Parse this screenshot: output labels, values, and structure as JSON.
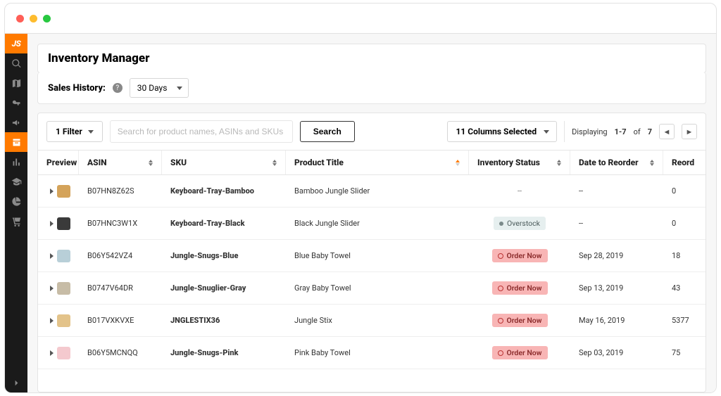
{
  "app": {
    "logo_text": "JS"
  },
  "sidebar": {
    "items": [
      {
        "name": "search"
      },
      {
        "name": "map"
      },
      {
        "name": "key"
      },
      {
        "name": "megaphone"
      },
      {
        "name": "inventory",
        "active": true
      },
      {
        "name": "bars"
      },
      {
        "name": "graduation"
      },
      {
        "name": "chart"
      },
      {
        "name": "cart"
      }
    ]
  },
  "page": {
    "title": "Inventory Manager",
    "history_label": "Sales History:",
    "history_value": "30 Days"
  },
  "toolbar": {
    "filter_label": "1 Filter",
    "search_placeholder": "Search for product names, ASINs and SKUs",
    "search_button": "Search",
    "columns_label": "11 Columns Selected",
    "displaying_label": "Displaying",
    "range": "1-7",
    "of": "of",
    "total": "7"
  },
  "columns": {
    "preview": "Preview",
    "asin": "ASIN",
    "sku": "SKU",
    "title": "Product Title",
    "status": "Inventory Status",
    "date": "Date to Reorder",
    "reorder": "Reord"
  },
  "status_labels": {
    "overstock": "Overstock",
    "order_now": "Order Now"
  },
  "rows": [
    {
      "asin": "B07HN8Z62S",
      "sku": "Keyboard-Tray-Bamboo",
      "title": "Bamboo Jungle Slider",
      "status": "dash",
      "date": "--",
      "reorder": "0",
      "thumb_color": "#d4a35a"
    },
    {
      "asin": "B07HNC3W1X",
      "sku": "Keyboard-Tray-Black",
      "title": "Black Jungle Slider",
      "status": "overstock",
      "date": "--",
      "reorder": "0",
      "thumb_color": "#3a3a3a"
    },
    {
      "asin": "B06Y542VZ4",
      "sku": "Jungle-Snugs-Blue",
      "title": "Blue Baby Towel",
      "status": "order_now",
      "date": "Sep 28, 2019",
      "reorder": "18",
      "thumb_color": "#b8cfd8"
    },
    {
      "asin": "B0747V64DR",
      "sku": "Jungle-Snuglier-Gray",
      "title": "Gray Baby Towel",
      "status": "order_now",
      "date": "Sep 13, 2019",
      "reorder": "43",
      "thumb_color": "#c7bca6"
    },
    {
      "asin": "B017VXKVXE",
      "sku": "JNGLESTIX36",
      "title": "Jungle Stix",
      "status": "order_now",
      "date": "May 16, 2019",
      "reorder": "5377",
      "thumb_color": "#e3c38a"
    },
    {
      "asin": "B06Y5MCNQQ",
      "sku": "Jungle-Snugs-Pink",
      "title": "Pink Baby Towel",
      "status": "order_now",
      "date": "Sep 03, 2019",
      "reorder": "75",
      "thumb_color": "#f4c9ce"
    }
  ]
}
